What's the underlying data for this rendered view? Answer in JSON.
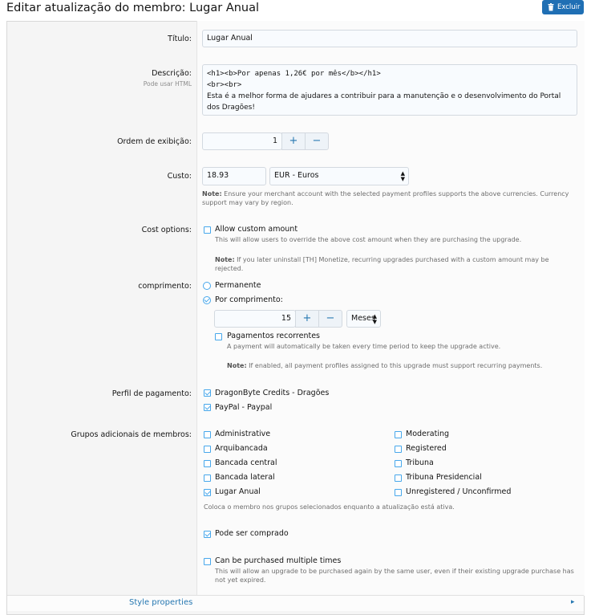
{
  "page": {
    "title": "Editar atualização do membro: Lugar Anual",
    "delete_label": "Excluir"
  },
  "fields": {
    "title": {
      "label": "Título:",
      "value": "Lugar Anual"
    },
    "description": {
      "label": "Descrição:",
      "hint": "Pode usar HTML",
      "line1": "<h1><b>Por apenas 1,26€ por mês</b></h1>",
      "line2": "<br><br>",
      "line3": "Esta é a melhor forma de ajudares a contribuir para a manutenção e o desenvolvimento do Portal dos Dragões!"
    },
    "display_order": {
      "label": "Ordem de exibição:",
      "value": "1",
      "plus": "+",
      "minus": "−"
    },
    "cost": {
      "label": "Custo:",
      "amount": "18.93",
      "currency": "EUR - Euros",
      "note_bold": "Note:",
      "note": " Ensure your merchant account with the selected payment profiles supports the above currencies. Currency support may vary by region."
    },
    "cost_options": {
      "label": "Cost options:",
      "custom_amount": {
        "label": "Allow custom amount",
        "checked": false
      },
      "custom_desc": "This will allow users to override the above cost amount when they are purchasing the upgrade.",
      "note_bold": "Note:",
      "note": " If you later uninstall [TH] Monetize, recurring upgrades purchased with a custom amount may be rejected."
    },
    "length": {
      "label": "comprimento:",
      "permanent": "Permanente",
      "by_length": "Por comprimento:",
      "amount": "15",
      "plus": "+",
      "minus": "−",
      "unit": "Meses",
      "recurring": {
        "label": "Pagamentos recorrentes",
        "checked": false
      },
      "recurring_desc": "A payment will automatically be taken every time period to keep the upgrade active.",
      "note_bold": "Note:",
      "note": " If enabled, all payment profiles assigned to this upgrade must support recurring payments."
    },
    "payment_profile": {
      "label": "Perfil de pagamento:",
      "options": [
        {
          "label": "DragonByte Credits - Dragões",
          "checked": true
        },
        {
          "label": "PayPal - Paypal",
          "checked": true
        }
      ]
    },
    "groups": {
      "label": "Grupos adicionais de membros:",
      "left": [
        {
          "label": "Administrative",
          "checked": false
        },
        {
          "label": "Arquibancada",
          "checked": false
        },
        {
          "label": "Bancada central",
          "checked": false
        },
        {
          "label": "Bancada lateral",
          "checked": false
        },
        {
          "label": "Lugar Anual",
          "checked": true
        }
      ],
      "right": [
        {
          "label": "Moderating",
          "checked": false
        },
        {
          "label": "Registered",
          "checked": false
        },
        {
          "label": "Tribuna",
          "checked": false
        },
        {
          "label": "Tribuna Presidencial",
          "checked": false
        },
        {
          "label": "Unregistered / Unconfirmed",
          "checked": false
        }
      ],
      "desc": "Coloca o membro nos grupos selecionados enquanto a atualização está ativa."
    },
    "can_purchase": {
      "label": "Pode ser comprado",
      "checked": true
    },
    "multiple": {
      "label": "Can be purchased multiple times",
      "checked": false,
      "desc": "This will allow an upgrade to be purchased again by the same user, even if their existing upgrade purchase has not yet expired."
    }
  },
  "footer": {
    "style_properties": "Style properties"
  },
  "colors": {
    "accent": "#47a7eb",
    "button": "#1f6fb4"
  }
}
